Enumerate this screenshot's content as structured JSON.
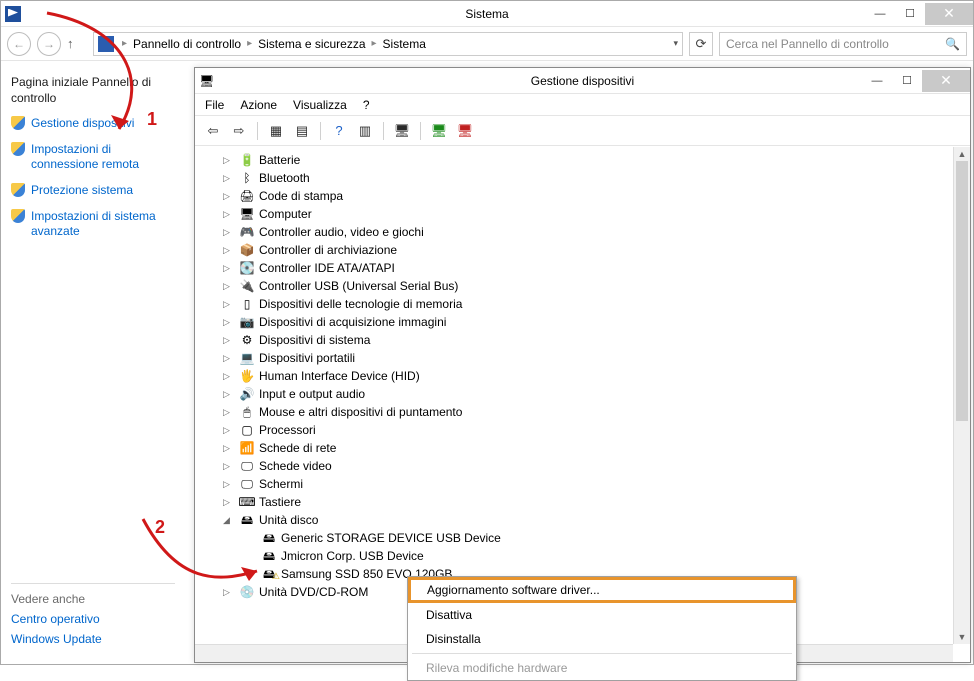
{
  "parent_window": {
    "title": "Sistema",
    "search_placeholder": "Cerca nel Pannello di controllo",
    "breadcrumb": {
      "root_icon": "control-panel",
      "parts": [
        "Pannello di controllo",
        "Sistema e sicurezza",
        "Sistema"
      ]
    }
  },
  "sidebar": {
    "heading": "Pagina iniziale Pannello di controllo",
    "links": [
      {
        "label": "Gestione dispositivi"
      },
      {
        "label": "Impostazioni di connessione remota"
      },
      {
        "label": "Protezione sistema"
      },
      {
        "label": "Impostazioni di sistema avanzate"
      }
    ],
    "see_also_title": "Vedere anche",
    "see_also": [
      "Centro operativo",
      "Windows Update"
    ]
  },
  "devmgr": {
    "title": "Gestione dispositivi",
    "menu": [
      "File",
      "Azione",
      "Visualizza",
      "?"
    ],
    "categories": [
      {
        "icon": "🔋",
        "label": "Batterie"
      },
      {
        "icon": "ᛒ",
        "label": "Bluetooth"
      },
      {
        "icon": "🖨",
        "label": "Code di stampa"
      },
      {
        "icon": "🖥",
        "label": "Computer"
      },
      {
        "icon": "🎮",
        "label": "Controller audio, video e giochi"
      },
      {
        "icon": "📦",
        "label": "Controller di archiviazione"
      },
      {
        "icon": "💽",
        "label": "Controller IDE ATA/ATAPI"
      },
      {
        "icon": "🔌",
        "label": "Controller USB (Universal Serial Bus)"
      },
      {
        "icon": "▯",
        "label": "Dispositivi delle tecnologie di memoria"
      },
      {
        "icon": "📷",
        "label": "Dispositivi di acquisizione immagini"
      },
      {
        "icon": "⚙",
        "label": "Dispositivi di sistema"
      },
      {
        "icon": "💻",
        "label": "Dispositivi portatili"
      },
      {
        "icon": "🖐",
        "label": "Human Interface Device (HID)"
      },
      {
        "icon": "🔊",
        "label": "Input e output audio"
      },
      {
        "icon": "🖱",
        "label": "Mouse e altri dispositivi di puntamento"
      },
      {
        "icon": "▢",
        "label": "Processori"
      },
      {
        "icon": "📶",
        "label": "Schede di rete"
      },
      {
        "icon": "🖵",
        "label": "Schede video"
      },
      {
        "icon": "🖵",
        "label": "Schermi"
      },
      {
        "icon": "⌨",
        "label": "Tastiere"
      }
    ],
    "disk_category": {
      "icon": "🖴",
      "label": "Unità disco"
    },
    "disks": [
      {
        "icon": "🖴",
        "label": "Generic STORAGE DEVICE USB Device",
        "warn": false
      },
      {
        "icon": "🖴",
        "label": "Jmicron Corp. USB Device",
        "warn": false
      },
      {
        "icon": "🖴",
        "label": "Samsung SSD 850 EVO 120GB",
        "warn": true
      }
    ],
    "dvd_category": {
      "icon": "💿",
      "label": "Unità DVD/CD-ROM"
    }
  },
  "context_menu": {
    "items": [
      {
        "label": "Aggiornamento software driver...",
        "highlight": true
      },
      {
        "label": "Disattiva"
      },
      {
        "label": "Disinstalla"
      },
      {
        "label": "Rileva modifiche hardware",
        "faded": true
      }
    ]
  },
  "annotations": {
    "one": "1",
    "two": "2"
  }
}
